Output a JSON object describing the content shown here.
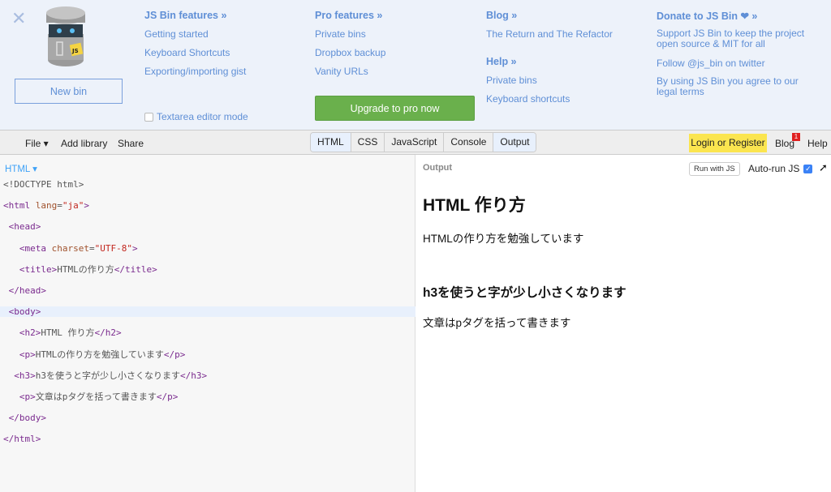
{
  "top": {
    "new_bin": "New bin",
    "textarea_mode": "Textarea editor mode",
    "upgrade": "Upgrade to pro now",
    "logo_text": "JS",
    "col1": {
      "title": "JS Bin features »",
      "links": [
        "Getting started",
        "Keyboard Shortcuts",
        "Exporting/importing gist"
      ]
    },
    "col2": {
      "title": "Pro features »",
      "links": [
        "Private bins",
        "Dropbox backup",
        "Vanity URLs"
      ]
    },
    "col3": {
      "title": "Blog »",
      "links": [
        "The Return and The Refactor"
      ],
      "title2": "Help »",
      "links2": [
        "Private bins",
        "Keyboard shortcuts"
      ]
    },
    "col4": {
      "title": "Donate to JS Bin ❤ »",
      "links": [
        "Support JS Bin to keep the project open source & MIT for all",
        "Follow @js_bin on twitter",
        "By using JS Bin you agree to our legal terms"
      ]
    }
  },
  "toolbar": {
    "file": "File ▾",
    "add_library": "Add library",
    "share": "Share",
    "tabs": [
      "HTML",
      "CSS",
      "JavaScript",
      "Console",
      "Output"
    ],
    "login": "Login or Register",
    "blog": "Blog",
    "blog_badge": "1",
    "help": "Help"
  },
  "editor": {
    "label": "HTML ▾",
    "lines": [
      [
        [
          "plain",
          "<!DOCTYPE html>"
        ]
      ],
      [
        [
          "tag",
          "<html "
        ],
        [
          "attr",
          "lang"
        ],
        [
          "plain",
          "="
        ],
        [
          "str",
          "\"ja\""
        ],
        [
          "tag",
          ">"
        ]
      ],
      [
        [
          "plain",
          " "
        ],
        [
          "tag",
          "<head>"
        ]
      ],
      [
        [
          "plain",
          "   "
        ],
        [
          "tag",
          "<meta "
        ],
        [
          "attr",
          "charset"
        ],
        [
          "plain",
          "="
        ],
        [
          "str",
          "\"UTF-8\""
        ],
        [
          "tag",
          ">"
        ]
      ],
      [
        [
          "plain",
          "   "
        ],
        [
          "tag",
          "<title>"
        ],
        [
          "plain",
          "HTMLの作り方"
        ],
        [
          "tag",
          "</title>"
        ]
      ],
      [
        [
          "plain",
          " "
        ],
        [
          "tag",
          "</head>"
        ]
      ],
      [
        [
          "plain",
          " "
        ],
        [
          "tag",
          "<body>"
        ]
      ],
      [
        [
          "plain",
          "   "
        ],
        [
          "tag",
          "<h2>"
        ],
        [
          "plain",
          "HTML 作り方"
        ],
        [
          "tag",
          "</h2>"
        ]
      ],
      [
        [
          "plain",
          "   "
        ],
        [
          "tag",
          "<p>"
        ],
        [
          "plain",
          "HTMLの作り方を勉強しています"
        ],
        [
          "tag",
          "</p>"
        ]
      ],
      [
        [
          "plain",
          "  "
        ],
        [
          "tag",
          "<h3>"
        ],
        [
          "plain",
          "h3を使うと字が少し小さくなります"
        ],
        [
          "tag",
          "</h3>"
        ]
      ],
      [
        [
          "plain",
          "   "
        ],
        [
          "tag",
          "<p>"
        ],
        [
          "plain",
          "文章はpタグを括って書きます"
        ],
        [
          "tag",
          "</p>"
        ]
      ],
      [
        [
          "plain",
          " "
        ],
        [
          "tag",
          "</body>"
        ]
      ],
      [
        [
          "tag",
          "</html>"
        ]
      ]
    ]
  },
  "output": {
    "label": "Output",
    "run_js": "Run with JS",
    "auto_run": "Auto-run JS",
    "h2": "HTML 作り方",
    "p1": "HTMLの作り方を勉強しています",
    "h3": "h3を使うと字が少し小さくなります",
    "p2": "文章はpタグを括って書きます"
  }
}
